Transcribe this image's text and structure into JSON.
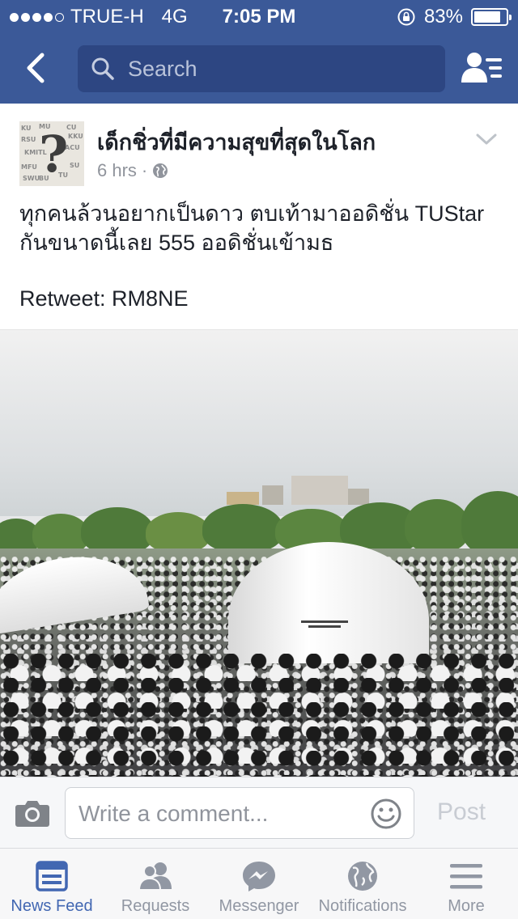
{
  "status_bar": {
    "carrier": "TRUE-H",
    "network": "4G",
    "time": "7:05 PM",
    "battery_percent": "83%",
    "battery_level": 0.83,
    "signal_bars_filled": 4,
    "signal_bars_total": 5
  },
  "nav": {
    "search_placeholder": "Search",
    "back_icon": "chevron-left-icon",
    "friends_icon": "friends-list-icon"
  },
  "post": {
    "author": "เด็กชิ่วที่มีความสุขที่สุดในโลก",
    "time": "6 hrs",
    "separator": "·",
    "privacy_icon": "globe-icon",
    "text_line1": "ทุกคนล้วนอยากเป็นดาว ตบเท้ามาออดิชั่น TUStar",
    "text_line2": "กันขนาดนี้เลย 555 ออดิชั่นเข้ามธ",
    "retweet": "Retweet: RM8NE",
    "avatar_words": [
      "KU",
      "MU",
      "CU",
      "RSU",
      "KMITL",
      "ACU",
      "MFU",
      "SU",
      "BU",
      "TU",
      "SWU",
      "KKU"
    ]
  },
  "comment": {
    "placeholder": "Write a comment...",
    "post_label": "Post"
  },
  "tabs": [
    {
      "label": "News Feed",
      "icon": "news-feed-icon",
      "active": true
    },
    {
      "label": "Requests",
      "icon": "friend-requests-icon",
      "active": false
    },
    {
      "label": "Messenger",
      "icon": "messenger-icon",
      "active": false
    },
    {
      "label": "Notifications",
      "icon": "globe-notifications-icon",
      "active": false
    },
    {
      "label": "More",
      "icon": "hamburger-menu-icon",
      "active": false
    }
  ],
  "colors": {
    "brand": "#3b5998",
    "active_tab": "#4267b2",
    "inactive_tab": "#9197a3"
  }
}
